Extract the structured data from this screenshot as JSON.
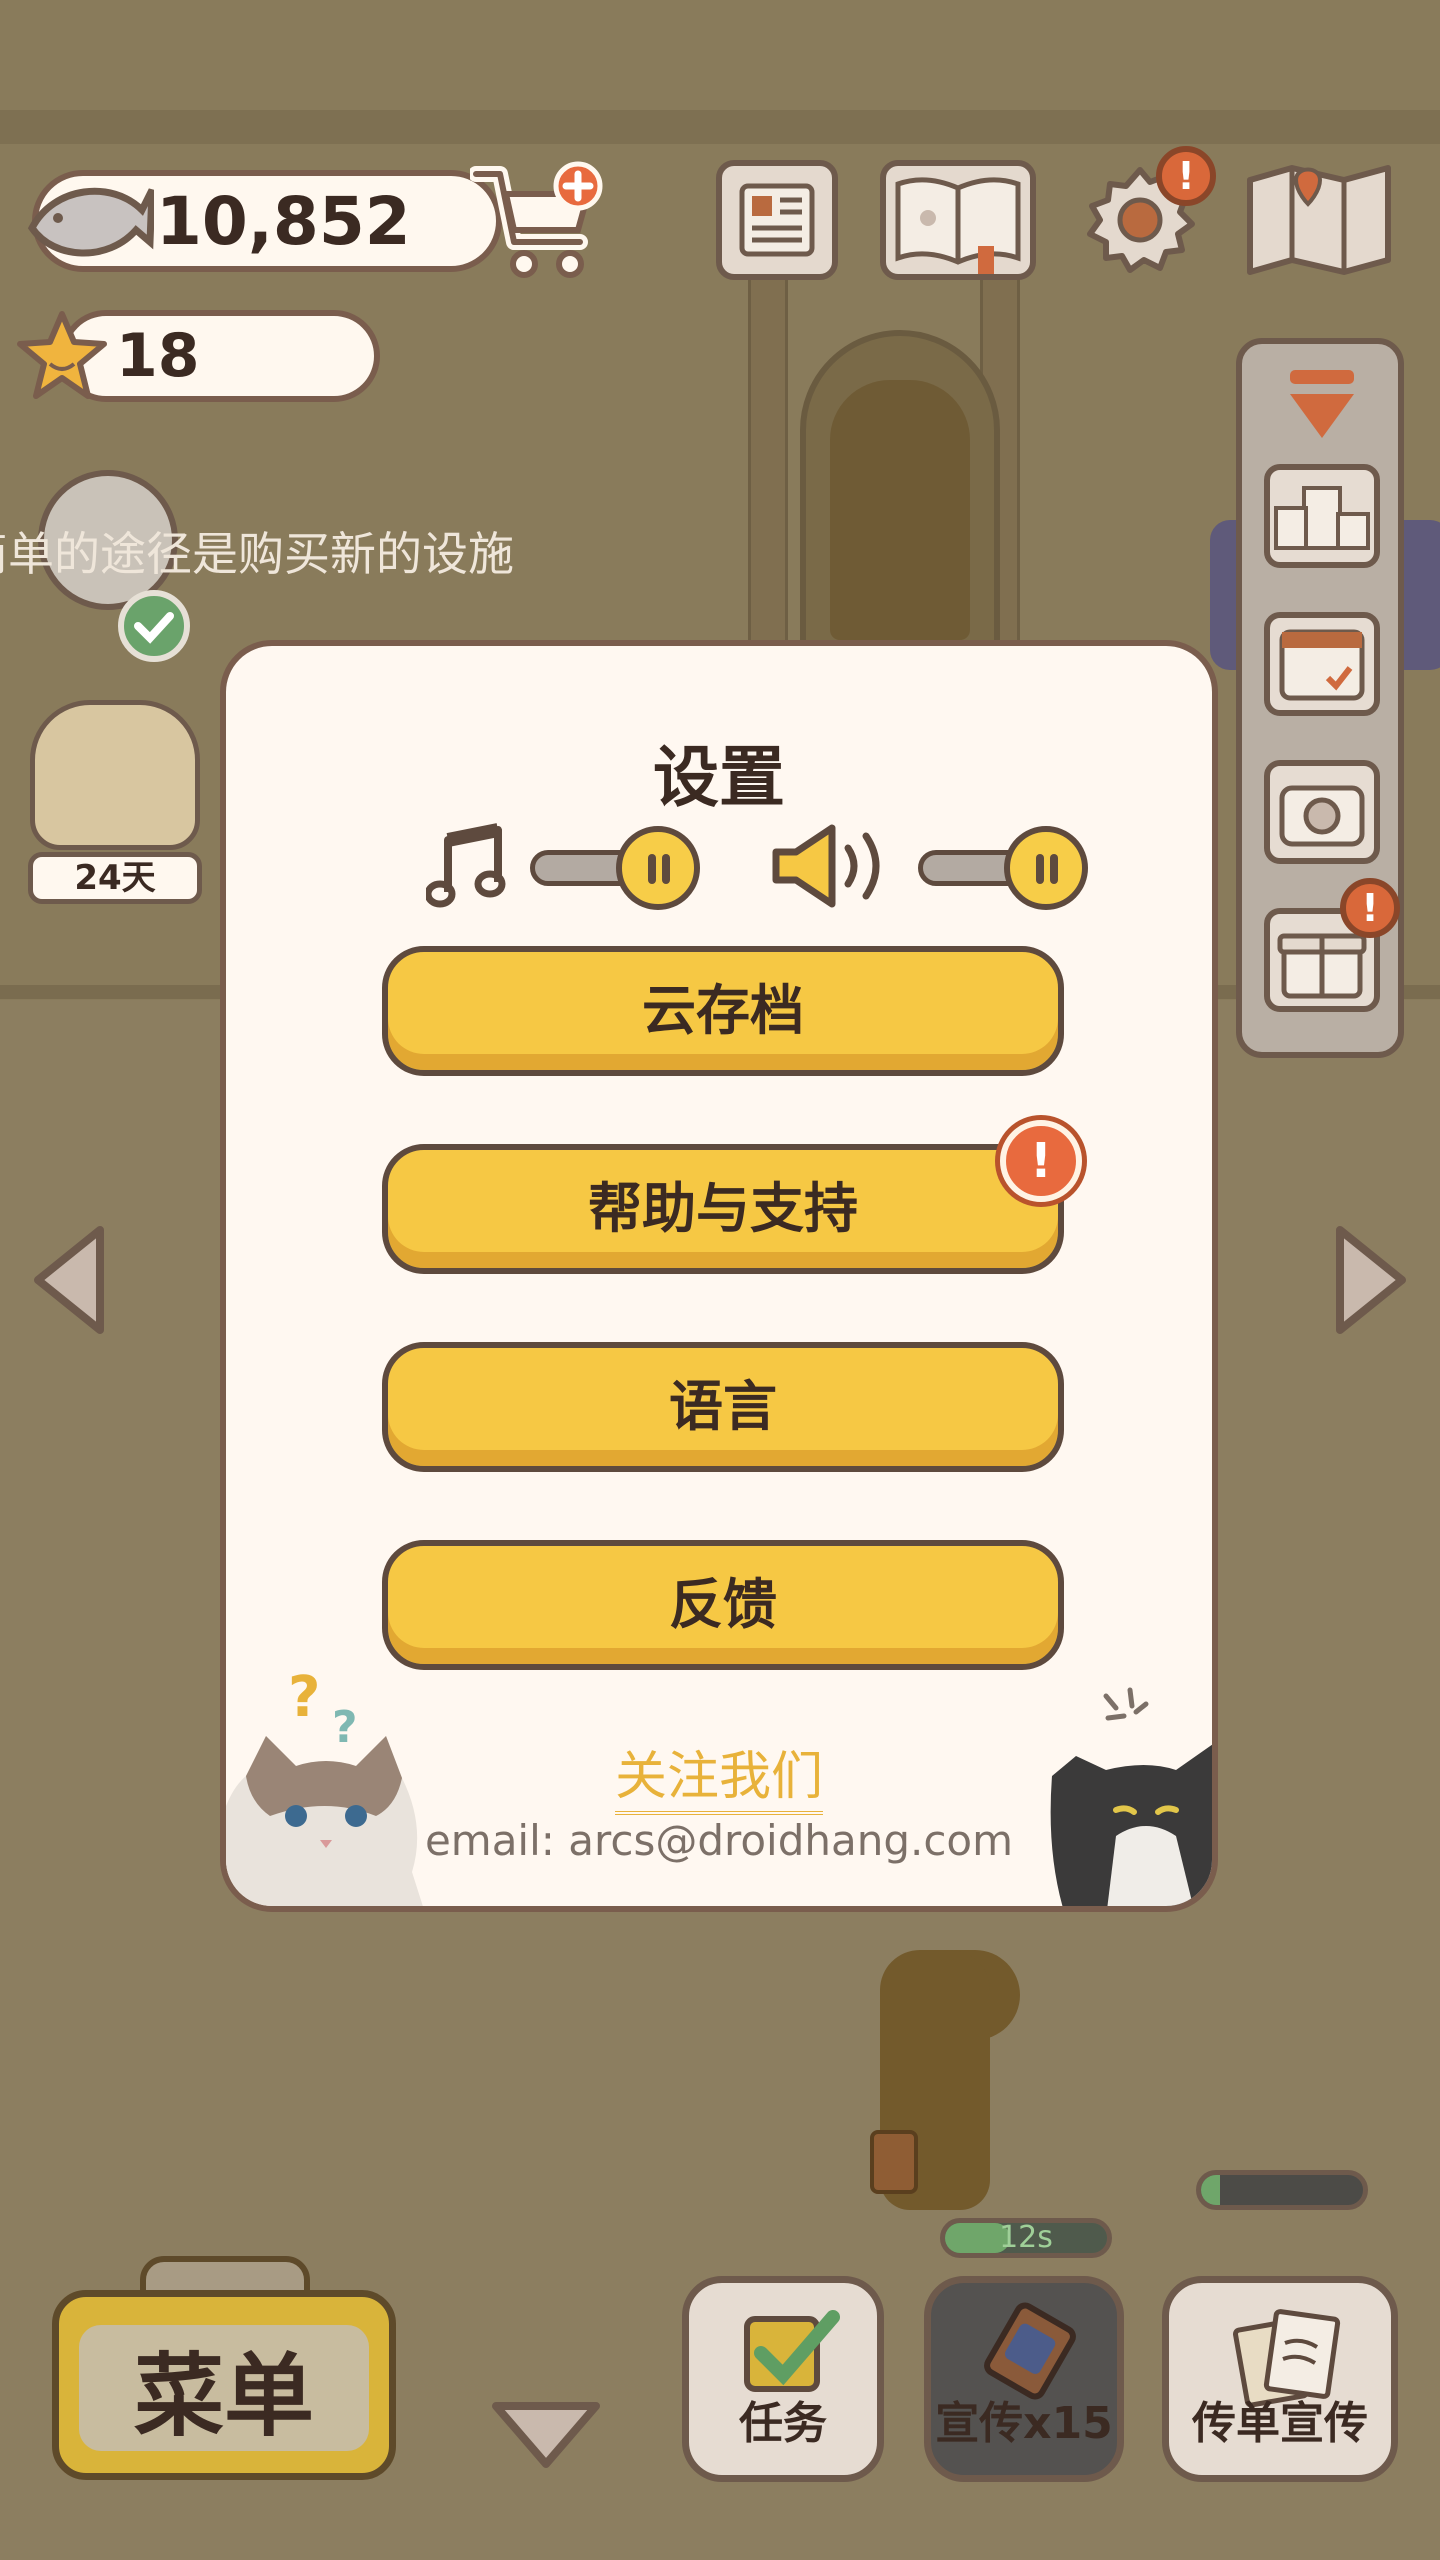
{
  "hud": {
    "fish_count": "10,852",
    "star_count": "18"
  },
  "hint": {
    "text": "简单的途径是购买新的设施",
    "days": "24天"
  },
  "settings": {
    "title": "设置",
    "buttons": [
      {
        "label": "云存档"
      },
      {
        "label": "帮助与支持",
        "badge": "!"
      },
      {
        "label": "语言"
      },
      {
        "label": "反馈"
      }
    ],
    "follow_label": "关注我们",
    "email": "email: arcs@droidhang.com",
    "music_on": true,
    "sound_on": true
  },
  "bottom": {
    "menu_label": "菜单",
    "tasks_label": "任务",
    "promo_label": "宣传x15",
    "flyer_label": "传单宣传",
    "timer": "12s"
  },
  "colors": {
    "accent_yellow": "#f6c844",
    "badge_orange": "#e86a3e",
    "outline_brown": "#5e4a3e",
    "follow_gold": "#e8b23a"
  }
}
